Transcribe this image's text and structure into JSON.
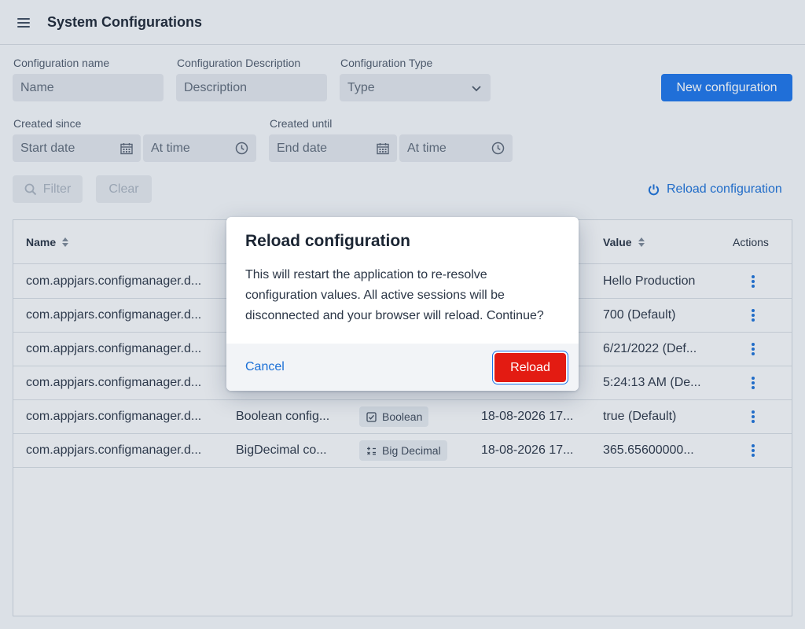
{
  "header": {
    "title": "System Configurations"
  },
  "filters": {
    "name": {
      "label": "Configuration name",
      "placeholder": "Name"
    },
    "description": {
      "label": "Configuration Description",
      "placeholder": "Description"
    },
    "type": {
      "label": "Configuration Type",
      "placeholder": "Type"
    },
    "created_since": {
      "label": "Created since",
      "date_placeholder": "Start date",
      "time_placeholder": "At time"
    },
    "created_until": {
      "label": "Created until",
      "date_placeholder": "End date",
      "time_placeholder": "At time"
    },
    "filter_label": "Filter",
    "clear_label": "Clear"
  },
  "actions": {
    "new_configuration": "New configuration",
    "reload_configuration": "Reload configuration"
  },
  "grid": {
    "columns": {
      "name": "Name",
      "value": "Value",
      "actions": "Actions"
    },
    "rows": [
      {
        "name": "com.appjars.configmanager.d...",
        "description": "",
        "type": "",
        "created": "",
        "value": "Hello Production"
      },
      {
        "name": "com.appjars.configmanager.d...",
        "description": "",
        "type": "",
        "created": "",
        "value": "700 (Default)"
      },
      {
        "name": "com.appjars.configmanager.d...",
        "description": "",
        "type": "",
        "created": "",
        "value": "6/21/2022 (Def..."
      },
      {
        "name": "com.appjars.configmanager.d...",
        "description": "",
        "type": "",
        "created": "",
        "value": "5:24:13 AM (De..."
      },
      {
        "name": "com.appjars.configmanager.d...",
        "description": "Boolean config...",
        "type": "Boolean",
        "created": "18-08-2026 17...",
        "value": "true (Default)"
      },
      {
        "name": "com.appjars.configmanager.d...",
        "description": "BigDecimal co...",
        "type": "Big Decimal",
        "created": "18-08-2026 17...",
        "value": "365.65600000..."
      }
    ]
  },
  "dialog": {
    "title": "Reload configuration",
    "body": "This will restart the application to re-resolve configuration values. All active sessions will be disconnected and your browser will reload. Continue?",
    "cancel_label": "Cancel",
    "confirm_label": "Reload"
  },
  "colors": {
    "primary": "#1a73e8",
    "danger": "#e31b12",
    "link": "#1a6fd6"
  },
  "icons": {
    "menu": "menu-icon",
    "chevron": "chevron-down-icon",
    "calendar": "calendar-icon",
    "clock": "clock-icon",
    "search": "search-icon",
    "power": "power-icon",
    "checkbox": "checkbox-icon",
    "decimal": "decimal-icon",
    "kebab": "kebab-icon"
  }
}
